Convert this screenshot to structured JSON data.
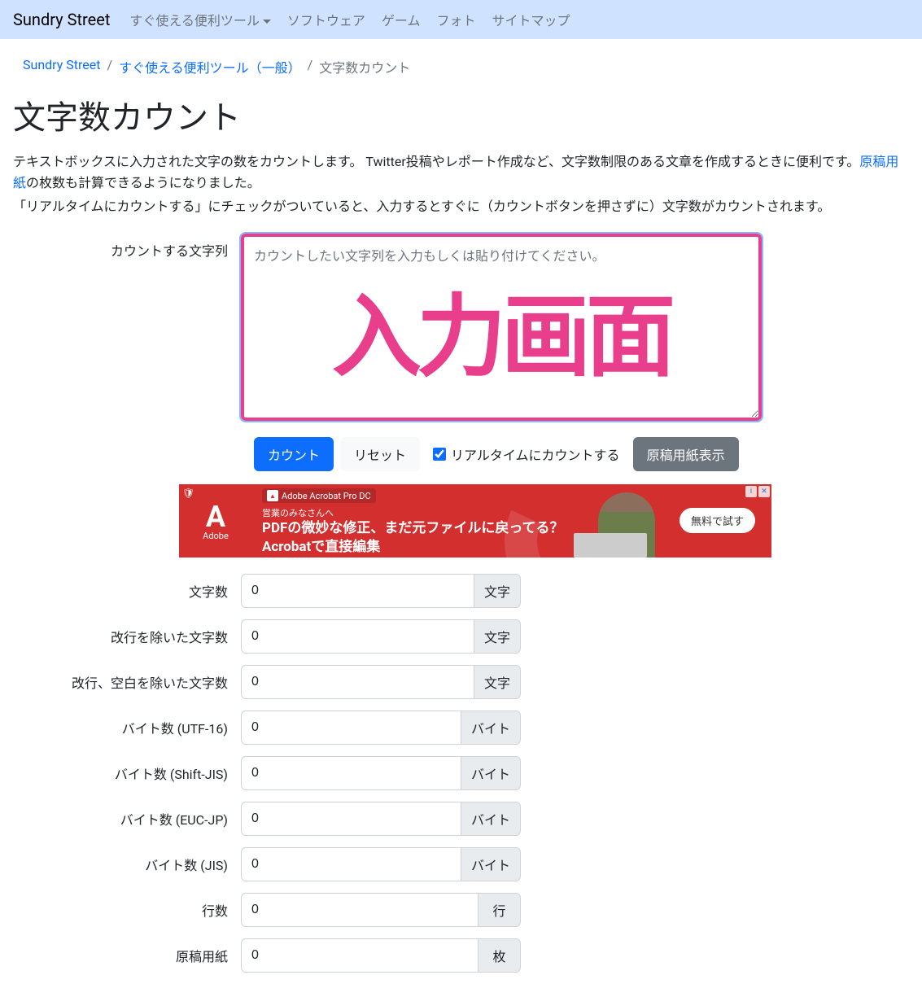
{
  "navbar": {
    "brand": "Sundry Street",
    "links": [
      {
        "label": "すぐ使える便利ツール",
        "dropdown": true
      },
      {
        "label": "ソフトウェア",
        "dropdown": false
      },
      {
        "label": "ゲーム",
        "dropdown": false
      },
      {
        "label": "フォト",
        "dropdown": false
      },
      {
        "label": "サイトマップ",
        "dropdown": false
      }
    ]
  },
  "breadcrumb": {
    "items": [
      {
        "label": "Sundry Street",
        "link": true
      },
      {
        "label": "すぐ使える便利ツール（一般）",
        "link": true
      },
      {
        "label": "文字数カウント",
        "link": false
      }
    ],
    "sep": "/"
  },
  "page": {
    "title": "文字数カウント",
    "desc1_pre": "テキストボックスに入力された文字の数をカウントします。 Twitter投稿やレポート作成など、文字数制限のある文章を作成するときに便利です。",
    "desc1_link": "原稿用紙",
    "desc1_post": "の枚数も計算できるようになりました。",
    "desc2": "「リアルタイムにカウントする」にチェックがついていると、入力するとすぐに（カウントボタンを押さずに）文字数がカウントされます。"
  },
  "form": {
    "input_label": "カウントする文字列",
    "placeholder": "カウントしたい文字列を入力もしくは貼り付けてください。",
    "overlay": "入力画面",
    "count_btn": "カウント",
    "reset_btn": "リセット",
    "realtime_label": "リアルタイムにカウントする",
    "realtime_checked": true,
    "genkou_btn": "原稿用紙表示"
  },
  "ad": {
    "brand_letter": "A",
    "brand_name": "Adobe",
    "tag": "Adobe Acrobat Pro DC",
    "small": "営業のみなさんへ",
    "line1": "PDFの微妙な修正、まだ元ファイルに戻ってる？",
    "line2": "Acrobatで直接編集",
    "cta": "無料で試す",
    "info_i": "i",
    "info_x": "✕",
    "shield": "🛡"
  },
  "results": [
    {
      "label": "文字数",
      "value": "0",
      "unit": "文字"
    },
    {
      "label": "改行を除いた文字数",
      "value": "0",
      "unit": "文字"
    },
    {
      "label": "改行、空白を除いた文字数",
      "value": "0",
      "unit": "文字"
    },
    {
      "label": "バイト数 (UTF-16)",
      "value": "0",
      "unit": "バイト"
    },
    {
      "label": "バイト数 (Shift-JIS)",
      "value": "0",
      "unit": "バイト"
    },
    {
      "label": "バイト数 (EUC-JP)",
      "value": "0",
      "unit": "バイト"
    },
    {
      "label": "バイト数 (JIS)",
      "value": "0",
      "unit": "バイト"
    },
    {
      "label": "行数",
      "value": "0",
      "unit": "行"
    },
    {
      "label": "原稿用紙",
      "value": "0",
      "unit": "枚"
    }
  ]
}
